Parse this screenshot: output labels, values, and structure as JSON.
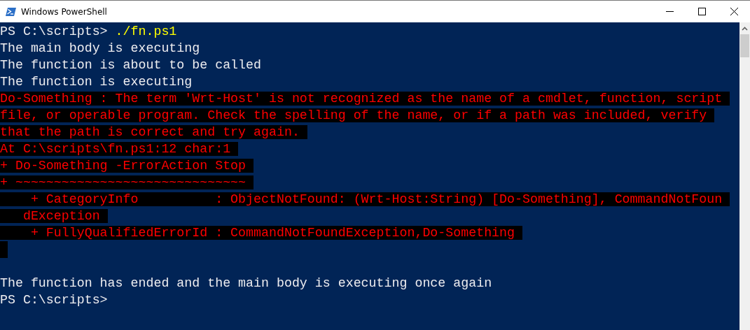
{
  "window": {
    "title": "Windows PowerShell"
  },
  "lines": [
    {
      "kind": "prompt",
      "prompt": "PS C:\\scripts>",
      "command": "./fn.ps1"
    },
    {
      "kind": "output",
      "text": "The main body is executing"
    },
    {
      "kind": "output",
      "text": "The function is about to be called"
    },
    {
      "kind": "output",
      "text": "The function is executing"
    },
    {
      "kind": "error",
      "text": "Do-Something : The term 'Wrt-Host' is not recognized as the name of a cmdlet, function, script"
    },
    {
      "kind": "error",
      "text": "file, or operable program. Check the spelling of the name, or if a path was included, verify"
    },
    {
      "kind": "error",
      "text": "that the path is correct and try again."
    },
    {
      "kind": "error",
      "text": "At C:\\scripts\\fn.ps1:12 char:1"
    },
    {
      "kind": "error",
      "text": "+ Do-Something -ErrorAction Stop"
    },
    {
      "kind": "error",
      "text": "+ ~~~~~~~~~~~~~~~~~~~~~~~~~~~~~~"
    },
    {
      "kind": "error",
      "text": "    + CategoryInfo          : ObjectNotFound: (Wrt-Host:String) [Do-Something], CommandNotFoun"
    },
    {
      "kind": "error",
      "text": "   dException"
    },
    {
      "kind": "error",
      "text": "    + FullyQualifiedErrorId : CommandNotFoundException,Do-Something"
    },
    {
      "kind": "error"
    },
    {
      "kind": "blank"
    },
    {
      "kind": "output",
      "text": "The function has ended and the main body is executing once again"
    },
    {
      "kind": "prompt",
      "prompt": "PS C:\\scripts>"
    }
  ]
}
